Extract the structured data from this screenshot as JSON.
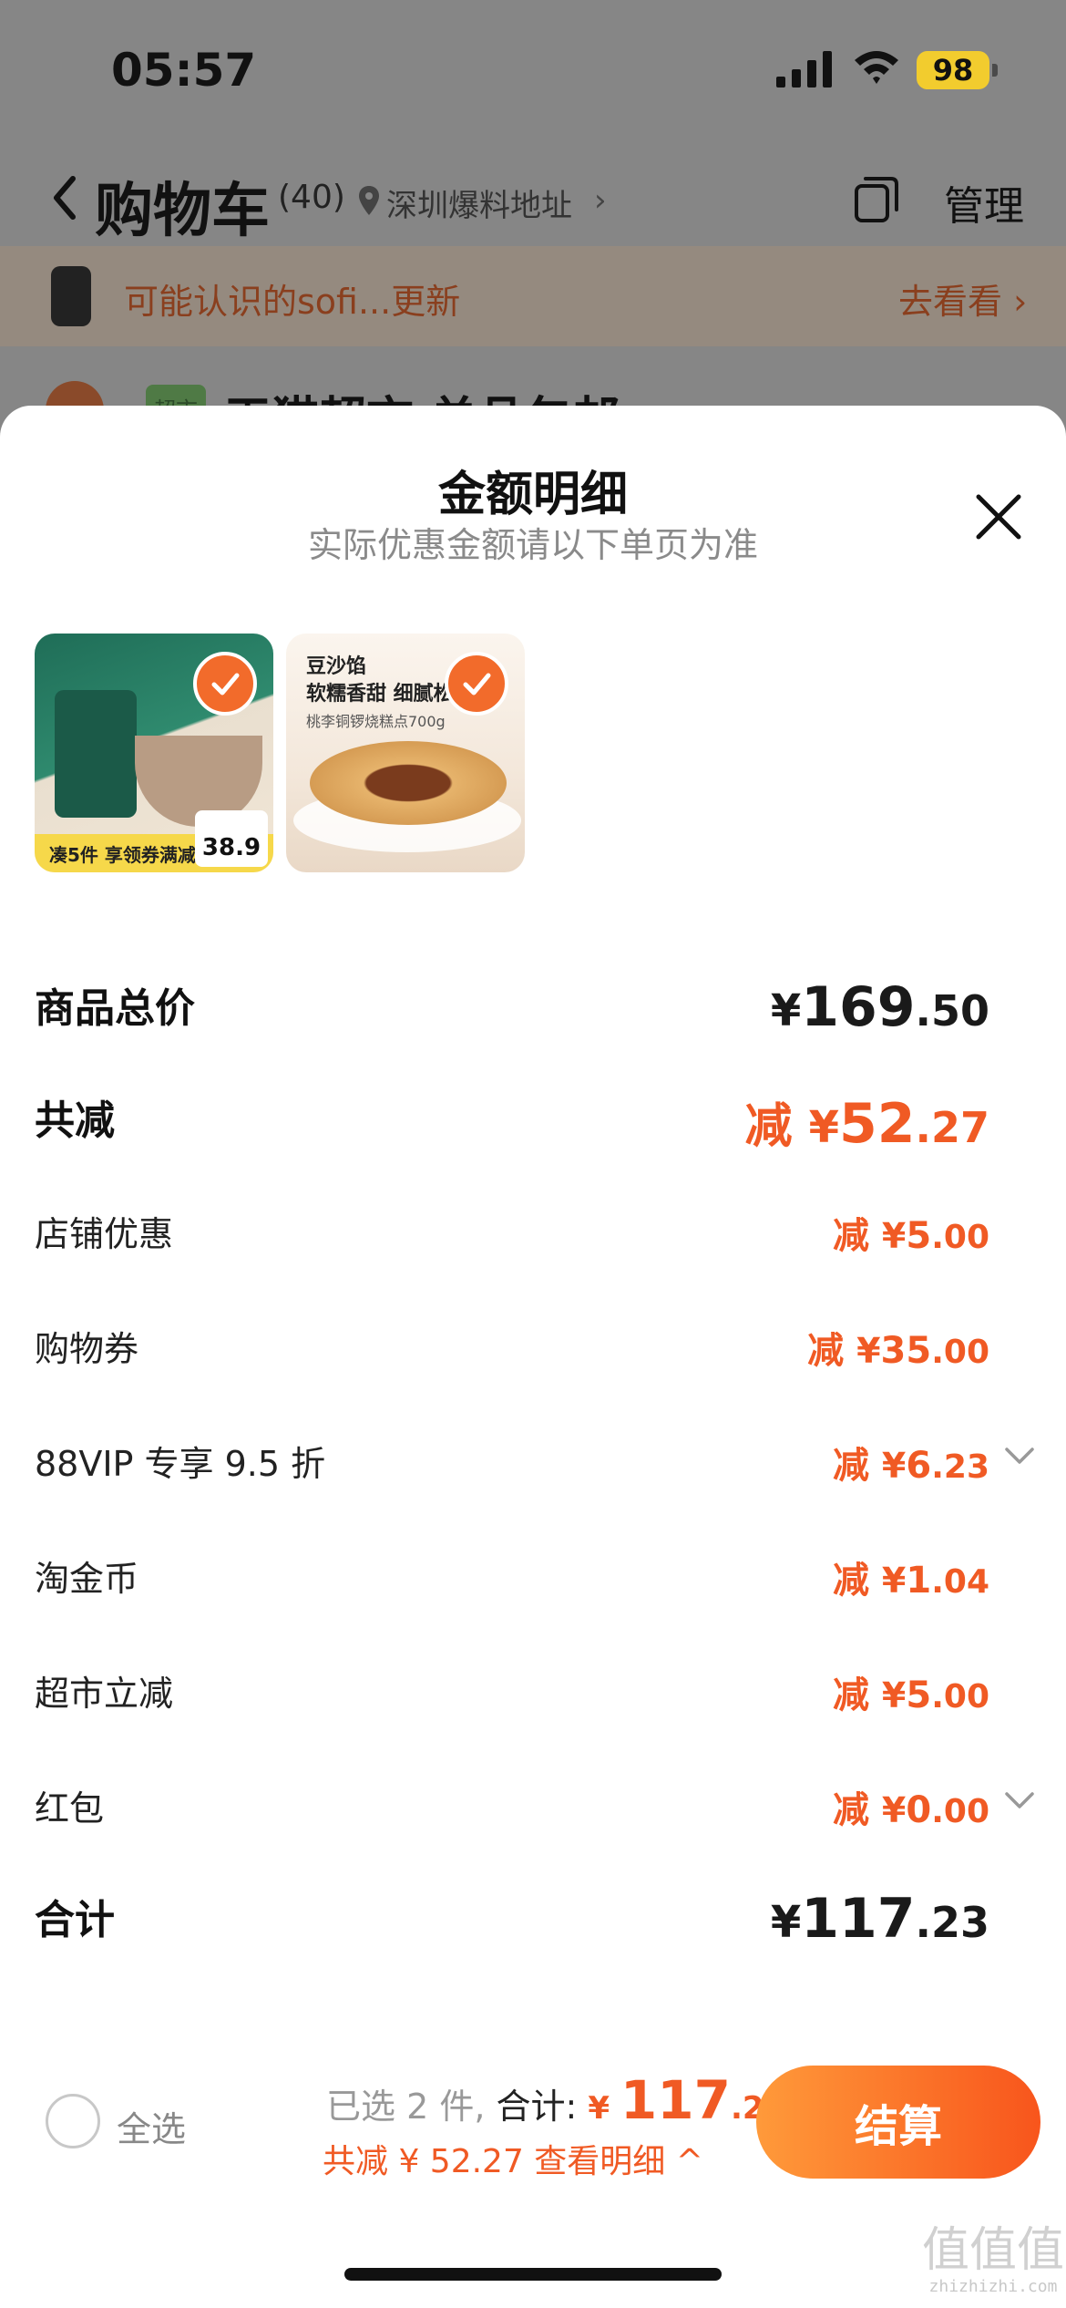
{
  "status_bar": {
    "time": "05:57",
    "battery": "98"
  },
  "cart_header": {
    "title": "购物车",
    "count": "(40)",
    "address": "深圳爆料地址",
    "address_chevron": "›",
    "manage_label": "管理"
  },
  "notice": {
    "text": "可能认识的sofi...更新",
    "link": "去看看 ›"
  },
  "store": {
    "badge": "超市",
    "name": "天猫超市 单品包邮 ›"
  },
  "sheet": {
    "title": "金额明细",
    "subtitle": "实际优惠金额请以下单页为准",
    "products": [
      {
        "name": "product-1",
        "banner": "凑5件 享领券满减",
        "price_tag": "38.9"
      },
      {
        "name": "product-2",
        "title_line1": "豆沙馅",
        "title_line2": "软糯香甜 细腻松软",
        "title_line3": "桃李铜锣烧糕点700g"
      }
    ],
    "rows": [
      {
        "label": "商品总价",
        "prefix": "",
        "symbol": "¥",
        "int": "169",
        "dec": ".50"
      },
      {
        "label": "共减",
        "prefix": "减 ",
        "symbol": "¥",
        "int": "52",
        "dec": ".27"
      },
      {
        "label": "店铺优惠",
        "prefix": "减 ",
        "symbol": "¥",
        "int": "5",
        "dec": ".00"
      },
      {
        "label": "购物券",
        "prefix": "减 ",
        "symbol": "¥",
        "int": "35",
        "dec": ".00"
      },
      {
        "label": "88VIP 专享 9.5 折",
        "prefix": "减 ",
        "symbol": "¥",
        "int": "6",
        "dec": ".23"
      },
      {
        "label": "淘金币",
        "prefix": "减 ",
        "symbol": "¥",
        "int": "1",
        "dec": ".04"
      },
      {
        "label": "超市立减",
        "prefix": "减 ",
        "symbol": "¥",
        "int": "5",
        "dec": ".00"
      },
      {
        "label": "红包",
        "prefix": "减 ",
        "symbol": "¥",
        "int": "0",
        "dec": ".00"
      },
      {
        "label": "合计",
        "prefix": "",
        "symbol": "¥",
        "int": "117",
        "dec": ".23"
      }
    ]
  },
  "bottom_bar": {
    "select_all_label": "全选",
    "selected_text": "已选 2 件, ",
    "total_label": "合计: ",
    "total_symbol": "¥ ",
    "total_int": "117",
    "total_dec": ".23",
    "discount_text": "共减 ¥ 52.27  查看明细 ^",
    "checkout_label": "结算"
  },
  "watermark": {
    "glyphs": "值值值",
    "url": "zhizhizhi.com"
  },
  "colors": {
    "accent": "#f05a24",
    "checkout_gradient_start": "#ff9a3a",
    "checkout_gradient_end": "#f8551c"
  }
}
